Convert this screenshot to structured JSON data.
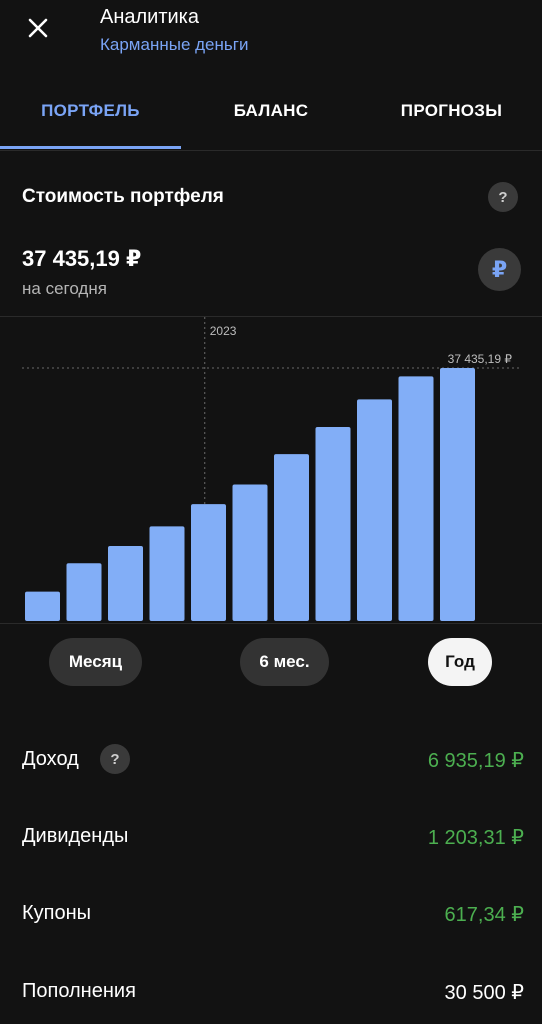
{
  "header": {
    "title": "Аналитика",
    "subtitle": "Карманные деньги"
  },
  "tabs": [
    {
      "label": "ПОРТФЕЛЬ",
      "active": true
    },
    {
      "label": "БАЛАНС",
      "active": false
    },
    {
      "label": "ПРОГНОЗЫ",
      "active": false
    }
  ],
  "portfolio": {
    "section_title": "Стоимость портфеля",
    "help_symbol": "?",
    "value": "37 435,19 ₽",
    "value_caption": "на сегодня",
    "currency_symbol": "₽"
  },
  "chart_data": {
    "type": "bar",
    "categories": [
      "",
      "",
      "",
      "",
      "",
      "",
      "",
      "",
      "",
      "",
      "",
      ""
    ],
    "values": [
      4350,
      8550,
      11100,
      14000,
      17300,
      20200,
      24700,
      28700,
      32800,
      36200,
      37435.19
    ],
    "ylim": [
      0,
      37435.19
    ],
    "year_marker": {
      "label": "2023",
      "after_index": 3
    },
    "reference_line": {
      "value": 37435.19,
      "label": "37 435,19 ₽"
    },
    "bar_color": "#82aef7"
  },
  "periods": [
    {
      "label": "Месяц",
      "selected": false
    },
    {
      "label": "6 мес.",
      "selected": false
    },
    {
      "label": "Год",
      "selected": true
    }
  ],
  "stats": [
    {
      "label": "Доход",
      "value": "6 935,19 ₽",
      "color": "green",
      "has_help": true
    },
    {
      "label": "Дивиденды",
      "value": "1 203,31 ₽",
      "color": "green",
      "has_help": false
    },
    {
      "label": "Купоны",
      "value": "617,34 ₽",
      "color": "green",
      "has_help": false
    },
    {
      "label": "Пополнения",
      "value": "30 500 ₽",
      "color": "white",
      "has_help": false
    }
  ],
  "colors": {
    "accent": "#7aa4f5",
    "positive": "#4caf50",
    "background": "#121212"
  }
}
